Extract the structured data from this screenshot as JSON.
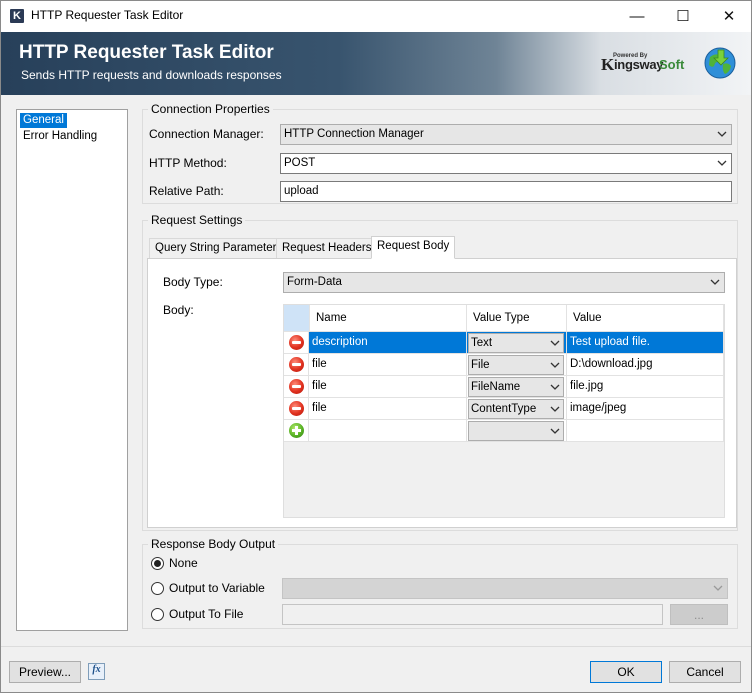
{
  "window": {
    "title": "HTTP Requester Task Editor",
    "minimize": "—",
    "maximize": "☐",
    "close": "✕"
  },
  "banner": {
    "title": "HTTP Requester Task Editor",
    "subtitle": "Sends HTTP requests and downloads responses",
    "logo_powered": "Powered By",
    "logo_k": "K",
    "logo_word": "ingsway",
    "logo_soft": "Soft"
  },
  "nav": {
    "items": [
      {
        "label": "General",
        "selected": true
      },
      {
        "label": "Error Handling",
        "selected": false
      }
    ]
  },
  "connection": {
    "group_title": "Connection Properties",
    "manager_label": "Connection Manager:",
    "manager_value": "HTTP Connection Manager",
    "method_label": "HTTP Method:",
    "method_value": "POST",
    "path_label": "Relative Path:",
    "path_value": "upload"
  },
  "request": {
    "group_title": "Request Settings",
    "tabs": [
      {
        "label": "Query String Parameters",
        "active": false
      },
      {
        "label": "Request Headers",
        "active": false
      },
      {
        "label": "Request Body",
        "active": true
      }
    ],
    "body_type_label": "Body Type:",
    "body_type_value": "Form-Data",
    "body_label": "Body:",
    "grid": {
      "columns": [
        "Name",
        "Value Type",
        "Value"
      ],
      "rows": [
        {
          "name": "description",
          "value_type": "Text",
          "value": "Test upload file.",
          "selected": true
        },
        {
          "name": "file",
          "value_type": "File",
          "value": "D:\\download.jpg",
          "selected": false
        },
        {
          "name": "file",
          "value_type": "FileName",
          "value": "file.jpg",
          "selected": false
        },
        {
          "name": "file",
          "value_type": "ContentType",
          "value": "image/jpeg",
          "selected": false
        }
      ],
      "new_row": {
        "name": "",
        "value_type": "",
        "value": ""
      }
    }
  },
  "response": {
    "group_title": "Response Body Output",
    "options": [
      {
        "label": "None",
        "checked": true
      },
      {
        "label": "Output to Variable",
        "checked": false
      },
      {
        "label": "Output To File",
        "checked": false
      }
    ],
    "variable_value": "",
    "file_value": "",
    "browse_label": "..."
  },
  "footer": {
    "preview_label": "Preview...",
    "fx_label": "fx",
    "ok_label": "OK",
    "cancel_label": "Cancel"
  },
  "colors": {
    "selection": "#0078d7",
    "banner_dark": "#27405a",
    "remove_icon": "#e0301e",
    "add_icon": "#58b225"
  }
}
